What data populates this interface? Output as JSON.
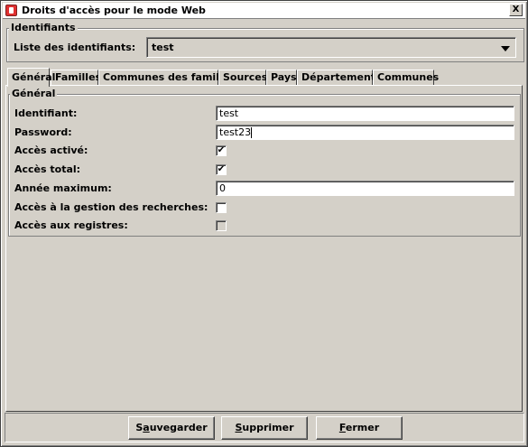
{
  "window": {
    "title": "Droits d'accès pour le mode Web",
    "close_glyph": "X"
  },
  "identifiants": {
    "legend": "Identifiants",
    "list_label": "Liste des identifiants:",
    "selected": "test"
  },
  "tabs": [
    {
      "label": "Général",
      "active": true
    },
    {
      "label": "Familles",
      "active": false
    },
    {
      "label": "Communes des familles",
      "active": false
    },
    {
      "label": "Sources",
      "active": false
    },
    {
      "label": "Pays",
      "active": false
    },
    {
      "label": "Départements",
      "active": false
    },
    {
      "label": "Communes",
      "active": false
    }
  ],
  "general": {
    "legend": "Général",
    "identifiant_label": "Identifiant:",
    "identifiant_value": "test",
    "password_label": "Password:",
    "password_value": "test23",
    "acces_active_label": "Accès activé:",
    "acces_active_checked": true,
    "acces_total_label": "Accès total:",
    "acces_total_checked": true,
    "annee_max_label": "Année maximum:",
    "annee_max_value": "0",
    "acces_recherches_label": "Accès à la gestion des recherches:",
    "acces_recherches_checked": false,
    "acces_registres_label": "Accès aux registres:",
    "acces_registres_checked": false,
    "check_glyph": "✔"
  },
  "buttons": {
    "save_mnemonic": "a",
    "save_rest_before": "S",
    "save_rest_after": "uvegarder",
    "delete_mnemonic": "S",
    "delete_rest": "upprimer",
    "close_mnemonic": "F",
    "close_rest": "ermer"
  }
}
